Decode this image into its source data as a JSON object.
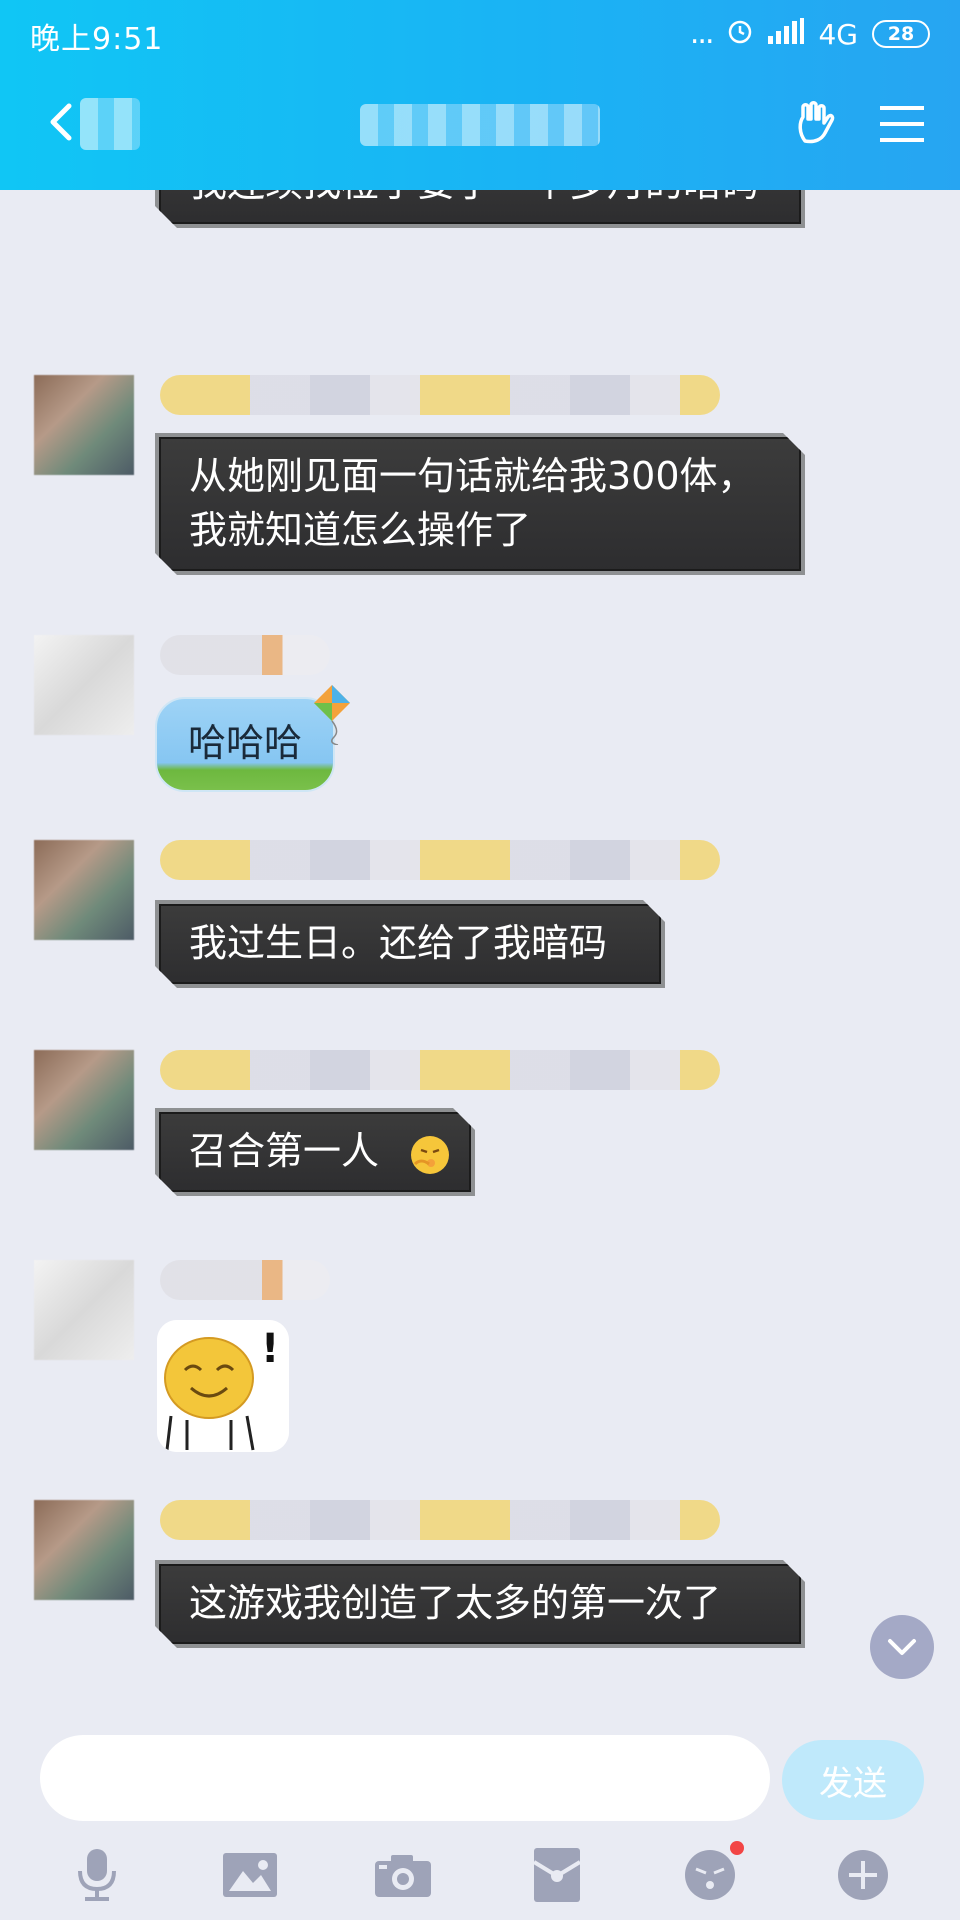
{
  "status_bar": {
    "time": "晚上9:51",
    "dots": "...",
    "network": "4G",
    "battery": "28"
  },
  "colors": {
    "header_gradient_start": "#10c6f5",
    "header_gradient_end": "#27a5f2",
    "chat_bg": "#e9ebf3",
    "dark_bubble": "#2d2d2f",
    "send_button": "#bfe9fb",
    "notification_dot": "#f24545"
  },
  "messages": [
    {
      "type": "text",
      "text": "我连续找橙子要了一个多月的暗码"
    },
    {
      "type": "text",
      "text": "从她刚见面一句话就给我300体，我就知道怎么操作了"
    },
    {
      "type": "text-blue",
      "text": "哈哈哈"
    },
    {
      "type": "text",
      "text": "我过生日。还给了我暗码"
    },
    {
      "type": "text",
      "text": "召合第一人"
    },
    {
      "type": "sticker",
      "text": "!"
    },
    {
      "type": "text",
      "text": "这游戏我创造了太多的第一次了"
    }
  ],
  "input": {
    "placeholder": "",
    "value": ""
  },
  "send_button": {
    "label": "发送"
  },
  "toolbar": {
    "icons": [
      "microphone-icon",
      "image-icon",
      "camera-icon",
      "red-packet-icon",
      "emoji-icon",
      "plus-icon"
    ]
  }
}
